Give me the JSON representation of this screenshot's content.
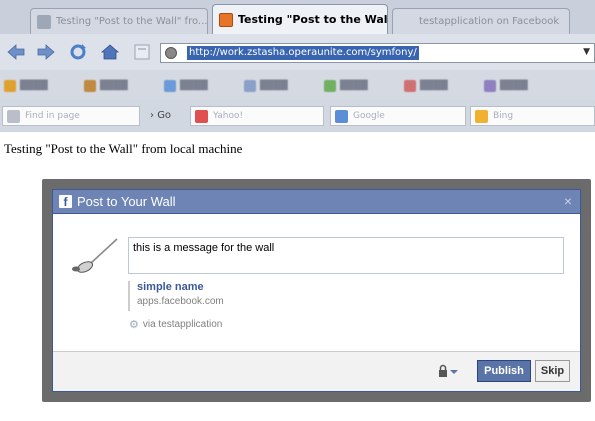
{
  "browser": {
    "tabs": [
      {
        "label": "Testing \"Post to the Wall\" fro...",
        "icon": "favicon-icon",
        "active": false
      },
      {
        "label": "Testing \"Post to the Wall...",
        "icon": "xampp-icon",
        "active": true
      },
      {
        "label": "testapplication on Facebook",
        "icon": "",
        "active": false
      }
    ],
    "url": "http://work.zstasha.operaunite.com/symfony/",
    "search": {
      "find_placeholder": "Find in page",
      "go_label": "Go",
      "engines": [
        "Yahoo!",
        "Google",
        "Bing"
      ]
    }
  },
  "page": {
    "heading": "Testing \"Post to the Wall\" from local machine"
  },
  "dialog": {
    "title": "Post to Your Wall",
    "close_glyph": "×",
    "message": "this is a message for the wall",
    "attachment": {
      "name": "simple name",
      "domain": "apps.facebook.com"
    },
    "via_text": "via testapplication",
    "publish_label": "Publish",
    "skip_label": "Skip"
  },
  "colors": {
    "facebook_blue": "#3b5998",
    "header_blue": "#6d84b4",
    "publish_bg": "#5b74a8"
  }
}
